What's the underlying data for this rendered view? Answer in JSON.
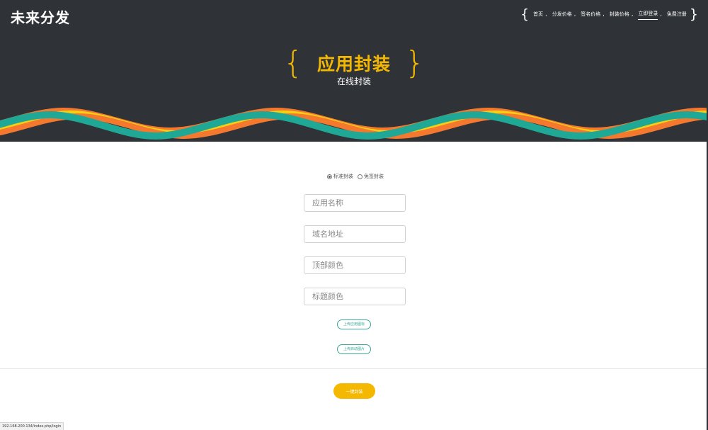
{
  "brand": {
    "logo": "未来分发"
  },
  "nav": {
    "items": [
      {
        "label": "首页",
        "sep": ","
      },
      {
        "label": "分发价格",
        "sep": ","
      },
      {
        "label": "签名价格",
        "sep": ","
      },
      {
        "label": "封装价格",
        "sep": ","
      },
      {
        "label": "立即登录",
        "sep": ","
      },
      {
        "label": "免费注册",
        "sep": ""
      }
    ],
    "active": "立即登录",
    "brace_left": "{",
    "brace_right": "}"
  },
  "hero": {
    "title": "应用封装",
    "subtitle": "在线封装",
    "brace_left": "{",
    "brace_right": "}",
    "title_color": "#f5b800"
  },
  "form": {
    "mode_options": [
      {
        "label": "标准封装",
        "checked": true
      },
      {
        "label": "免签封装",
        "checked": false
      }
    ],
    "fields": [
      {
        "placeholder": "应用名称",
        "value": ""
      },
      {
        "placeholder": "域名地址",
        "value": ""
      },
      {
        "placeholder": "顶部颜色",
        "value": ""
      },
      {
        "placeholder": "标题颜色",
        "value": ""
      }
    ],
    "upload_icon_label": "上传应用图标",
    "upload_splash_label": "上传启动图片",
    "submit_label": "一键封装"
  },
  "status_bar": {
    "url": "192.168.200.134/index.php/login"
  },
  "colors": {
    "header_bg": "#2f3236",
    "accent": "#f5b800",
    "wave_teal": "#1fa896",
    "wave_yellow": "#f7cf12",
    "wave_orange": "#f4792f",
    "pill_border": "#3aa79a"
  }
}
